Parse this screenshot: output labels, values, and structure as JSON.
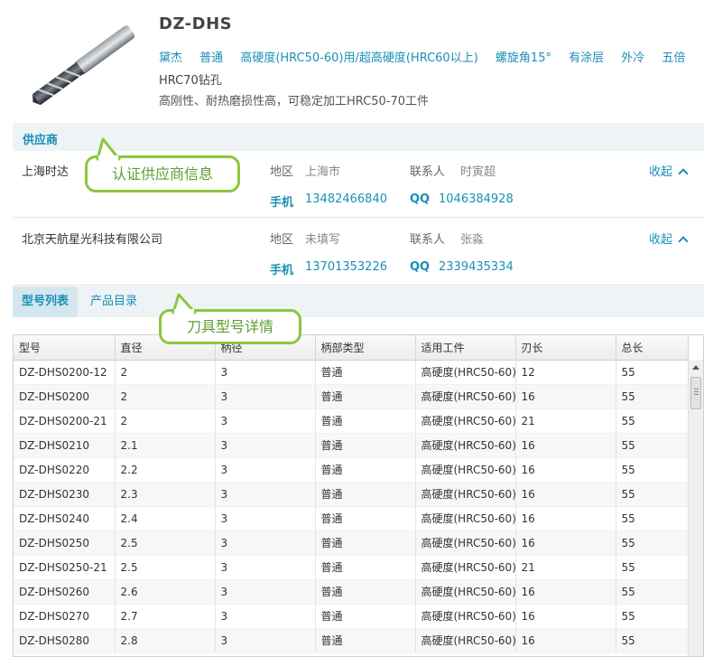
{
  "product": {
    "title": "DZ-DHS",
    "tags": [
      "黛杰",
      "普通",
      "高硬度(HRC50-60)用/超高硬度(HRC60以上)",
      "螺旋角15°",
      "有涂层",
      "外冷",
      "五倍"
    ],
    "tag_extra": "HRC70钻孔",
    "description": "高刚性、耐热磨损性高，可稳定加工HRC50-70工件"
  },
  "supplier_section": {
    "header": "供应商",
    "suppliers": [
      {
        "name": "上海时达",
        "region_label": "地区",
        "region": "上海市",
        "contact_label": "联系人",
        "contact": "时寅超",
        "phone_label": "手机",
        "phone": "13482466840",
        "qq_label": "QQ",
        "qq": "1046384928",
        "collapse_label": "收起"
      },
      {
        "name": "北京天航星光科技有限公司",
        "region_label": "地区",
        "region": "未填写",
        "contact_label": "联系人",
        "contact": "张淼",
        "phone_label": "手机",
        "phone": "13701353226",
        "qq_label": "QQ",
        "qq": "2339435334",
        "collapse_label": "收起"
      }
    ]
  },
  "callouts": {
    "supplier": "认证供应商信息",
    "models": "刀具型号详情"
  },
  "tabs": [
    "型号列表",
    "产品目录"
  ],
  "table": {
    "columns": [
      "型号",
      "直径",
      "柄径",
      "柄部类型",
      "适用工件",
      "刃长",
      "总长"
    ],
    "rows": [
      [
        "DZ-DHS0200-12",
        "2",
        "3",
        "普通",
        "高硬度(HRC50-60)/",
        "12",
        "55"
      ],
      [
        "DZ-DHS0200",
        "2",
        "3",
        "普通",
        "高硬度(HRC50-60)/",
        "16",
        "55"
      ],
      [
        "DZ-DHS0200-21",
        "2",
        "3",
        "普通",
        "高硬度(HRC50-60)/",
        "21",
        "55"
      ],
      [
        "DZ-DHS0210",
        "2.1",
        "3",
        "普通",
        "高硬度(HRC50-60)/",
        "16",
        "55"
      ],
      [
        "DZ-DHS0220",
        "2.2",
        "3",
        "普通",
        "高硬度(HRC50-60)/",
        "16",
        "55"
      ],
      [
        "DZ-DHS0230",
        "2.3",
        "3",
        "普通",
        "高硬度(HRC50-60)/",
        "16",
        "55"
      ],
      [
        "DZ-DHS0240",
        "2.4",
        "3",
        "普通",
        "高硬度(HRC50-60)/",
        "16",
        "55"
      ],
      [
        "DZ-DHS0250",
        "2.5",
        "3",
        "普通",
        "高硬度(HRC50-60)/",
        "16",
        "55"
      ],
      [
        "DZ-DHS0250-21",
        "2.5",
        "3",
        "普通",
        "高硬度(HRC50-60)/",
        "21",
        "55"
      ],
      [
        "DZ-DHS0260",
        "2.6",
        "3",
        "普通",
        "高硬度(HRC50-60)/",
        "16",
        "55"
      ],
      [
        "DZ-DHS0270",
        "2.7",
        "3",
        "普通",
        "高硬度(HRC50-60)/",
        "16",
        "55"
      ],
      [
        "DZ-DHS0280",
        "2.8",
        "3",
        "普通",
        "高硬度(HRC50-60)/",
        "16",
        "55"
      ]
    ]
  },
  "colors": {
    "accent": "#1a8fb5",
    "callout_border": "#8cc63f",
    "callout_text": "#5aa02c",
    "section_bg": "#eef3f6"
  }
}
